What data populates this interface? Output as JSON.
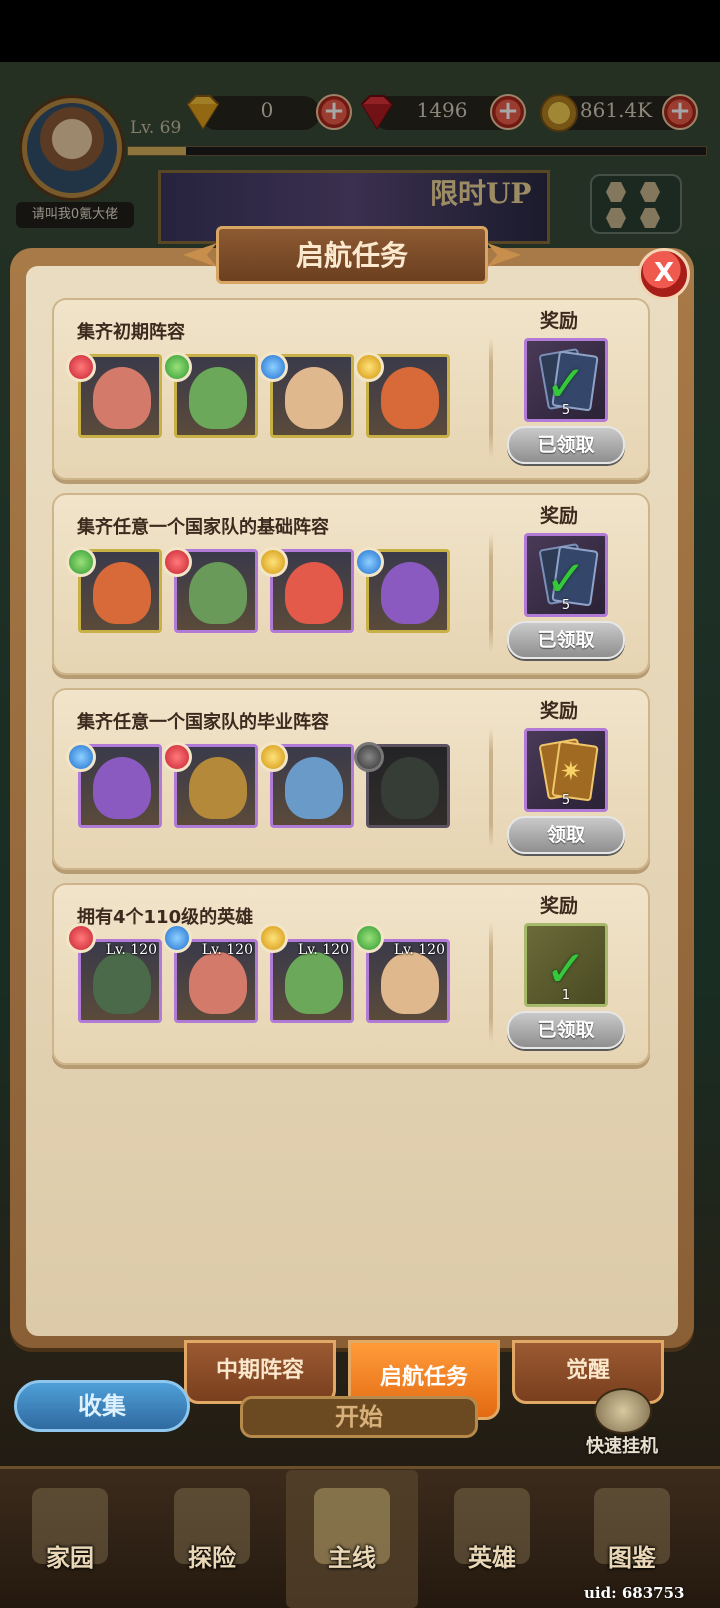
{
  "player": {
    "level": "Lv. 69",
    "name": "请叫我0氪大佬",
    "xp_fraction": 0.1
  },
  "resources": {
    "diamond": "0",
    "ruby": "1496",
    "gold": "861.4K"
  },
  "banner": {
    "text": "限时UP"
  },
  "dialog": {
    "title": "启航任务",
    "close": "X",
    "reward_label": "奖励"
  },
  "quests": [
    {
      "title": "集齐初期阵容",
      "heroes": [
        {
          "element": "red",
          "frame": "gold"
        },
        {
          "element": "green",
          "frame": "gold"
        },
        {
          "element": "blue",
          "frame": "gold"
        },
        {
          "element": "gold",
          "frame": "gold"
        }
      ],
      "reward_qty": "5",
      "reward_kind": "blue-cards",
      "claimed": true,
      "button": "已领取"
    },
    {
      "title": "集齐任意一个国家队的基础阵容",
      "heroes": [
        {
          "element": "green",
          "frame": "gold"
        },
        {
          "element": "red",
          "frame": "purple"
        },
        {
          "element": "gold",
          "frame": "purple"
        },
        {
          "element": "blue",
          "frame": "gold"
        }
      ],
      "reward_qty": "5",
      "reward_kind": "blue-cards",
      "claimed": true,
      "button": "已领取"
    },
    {
      "title": "集齐任意一个国家队的毕业阵容",
      "heroes": [
        {
          "element": "blue",
          "frame": "purple"
        },
        {
          "element": "red",
          "frame": "purple"
        },
        {
          "element": "gold",
          "frame": "purple"
        },
        {
          "element": "gray",
          "frame": "purple",
          "locked": true
        }
      ],
      "reward_qty": "5",
      "reward_kind": "gold-cards",
      "claimed": false,
      "button": "领取"
    },
    {
      "title": "拥有4个110级的英雄",
      "heroes": [
        {
          "element": "red",
          "frame": "purple",
          "level": "Lv. 120"
        },
        {
          "element": "blue",
          "frame": "purple",
          "level": "Lv. 120"
        },
        {
          "element": "gold",
          "frame": "purple",
          "level": "Lv. 120"
        },
        {
          "element": "green",
          "frame": "purple",
          "level": "Lv. 120"
        }
      ],
      "reward_qty": "1",
      "reward_kind": "level-ticket",
      "claimed": true,
      "button": "已领取"
    }
  ],
  "tabs": [
    "中期阵容",
    "启航任务",
    "觉醒"
  ],
  "active_tab": 1,
  "buttons": {
    "collect": "收集",
    "start": "开始",
    "afk": "快速挂机"
  },
  "nav": [
    {
      "label": "家园"
    },
    {
      "label": "探险"
    },
    {
      "label": "主线"
    },
    {
      "label": "英雄"
    },
    {
      "label": "图鉴"
    }
  ],
  "active_nav": 2,
  "uid": "uid: 683753",
  "colors": {
    "panel": "#e9dcc1",
    "frame": "#a87a47",
    "active_tab": "#ff9b3a",
    "claimed_button": "#a8a8a8"
  }
}
